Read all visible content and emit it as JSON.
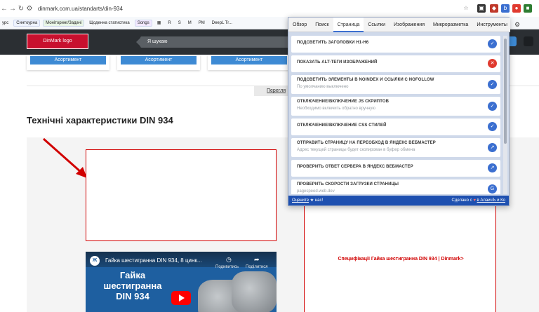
{
  "browser": {
    "url": "dinmark.com.ua/standarts/din-934",
    "bookmarks": [
      "урс",
      "Синтоурна",
      "Моніторинг/Задачі",
      "Щоденна статистика",
      "Songs",
      "R",
      "S",
      "M",
      "PM",
      "DeepL Tr..."
    ]
  },
  "site": {
    "logo_text": "DinMark logo",
    "search_placeholder": "Я шукаю",
    "product_button": "Асортимент",
    "tab_link": "Перегля",
    "section_title": "Технічні характеристики DIN 934",
    "video": {
      "title": "Гайка шестигранна DIN 934, 8 цинк...",
      "heading": "Гайка шестигранна DIN 934",
      "watch_later": "Подивитись",
      "share": "Поділитися",
      "badge": "Ж"
    },
    "spec_link": "Специфікації Гайка шестигранна DIN 934 | Dinmark>"
  },
  "popup": {
    "tabs": [
      "Обзор",
      "Поиск",
      "Страница",
      "Ссылки",
      "Изображения",
      "Микроразметка",
      "Инструменты"
    ],
    "active_tab": "Страница",
    "items": [
      {
        "label": "Подсветить заголовки H1-H6",
        "sub": "",
        "icon": "check-icon",
        "color": "#3b6fd0"
      },
      {
        "label": "Показать ALT-теги изображений",
        "sub": "",
        "icon": "close-icon",
        "color": "#e03a2f"
      },
      {
        "label": "Подсветить элементы в noindex и ссылки с nofollow",
        "sub": "По умолчанию выключено",
        "icon": "check-icon",
        "color": "#3b6fd0"
      },
      {
        "label": "Отключение/включение JS скриптов",
        "sub": "Необходимо включить обратно вручную",
        "icon": "check-icon",
        "color": "#3b6fd0"
      },
      {
        "label": "Отключение/включение CSS стилей",
        "sub": "",
        "icon": "check-icon",
        "color": "#3b6fd0"
      },
      {
        "label": "Отправить страницу на переобход в Яндекс Вебмастер",
        "sub": "Адрес текущей страницы будет скопирован в буфер обмена",
        "icon": "external-link-icon",
        "color": "#3b6fd0"
      },
      {
        "label": "Проверить ответ сервера в Яндекс Вебмастер",
        "sub": "",
        "icon": "external-link-icon",
        "color": "#3b6fd0"
      },
      {
        "label": "Проверить скорости загрузки страницы",
        "sub": "pagespeed.web.dev",
        "icon": "google-icon",
        "color": "#3b6fd0"
      }
    ],
    "footer_left_link": "Оцените",
    "footer_left_rest": "нас!",
    "footer_right_text": "Сделано с",
    "footer_right_link": "в АлаичЪ и Ко"
  }
}
